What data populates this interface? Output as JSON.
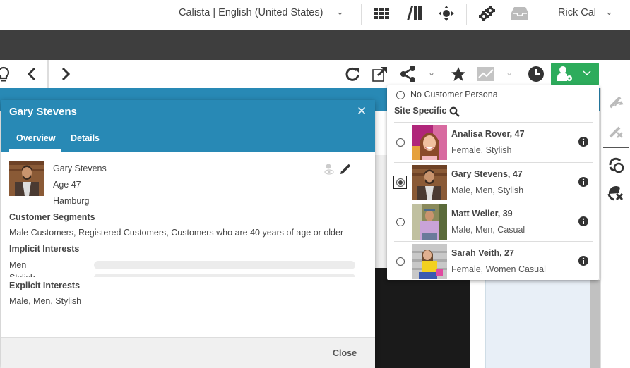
{
  "header": {
    "site_language": "Calista | English (United States)",
    "user_name": "Rick Cal",
    "icons": [
      "apps-grid-icon",
      "library-icon",
      "navigation-icon",
      "settings-gears-icon",
      "inbox-icon"
    ]
  },
  "toolbar": {
    "icons": [
      "lightbulb-icon",
      "back-icon",
      "forward-icon",
      "refresh-icon",
      "open-external-icon",
      "share-icon",
      "star-icon",
      "analytics-icon",
      "history-icon",
      "persona-icon"
    ]
  },
  "colors": {
    "brand_blue": "#2889b5",
    "persona_green": "#2dac5c",
    "dark_band": "#3e3e3e"
  },
  "modal": {
    "title": "Gary Stevens",
    "tabs": [
      {
        "label": "Overview",
        "active": true
      },
      {
        "label": "Details",
        "active": false
      }
    ],
    "profile": {
      "name": "Gary Stevens",
      "age": "Age 47",
      "city": "Hamburg"
    },
    "customer_segments": {
      "title": "Customer Segments",
      "value": "Male Customers, Registered Customers, Customers who are 40 years of age or older"
    },
    "implicit_interests": {
      "title": "Implicit Interests",
      "items": [
        {
          "label": "Men",
          "value": 0
        },
        {
          "label": "Stylish",
          "value": 0
        }
      ]
    },
    "explicit_interests": {
      "title": "Explicit Interests",
      "value": "Male, Men, Stylish"
    },
    "close_label": "Close"
  },
  "persona_dropdown": {
    "no_persona_label": "No Customer Persona",
    "group_label": "Site Specific",
    "personas": [
      {
        "name": "Analisa Rover, 47",
        "tags": "Female, Stylish",
        "selected": false
      },
      {
        "name": "Gary Stevens, 47",
        "tags": "Male, Men, Stylish",
        "selected": true
      },
      {
        "name": "Matt Weller, 39",
        "tags": "Male, Men, Casual",
        "selected": false
      },
      {
        "name": "Sarah Veith, 27",
        "tags": "Female, Women Casual",
        "selected": false
      }
    ]
  }
}
